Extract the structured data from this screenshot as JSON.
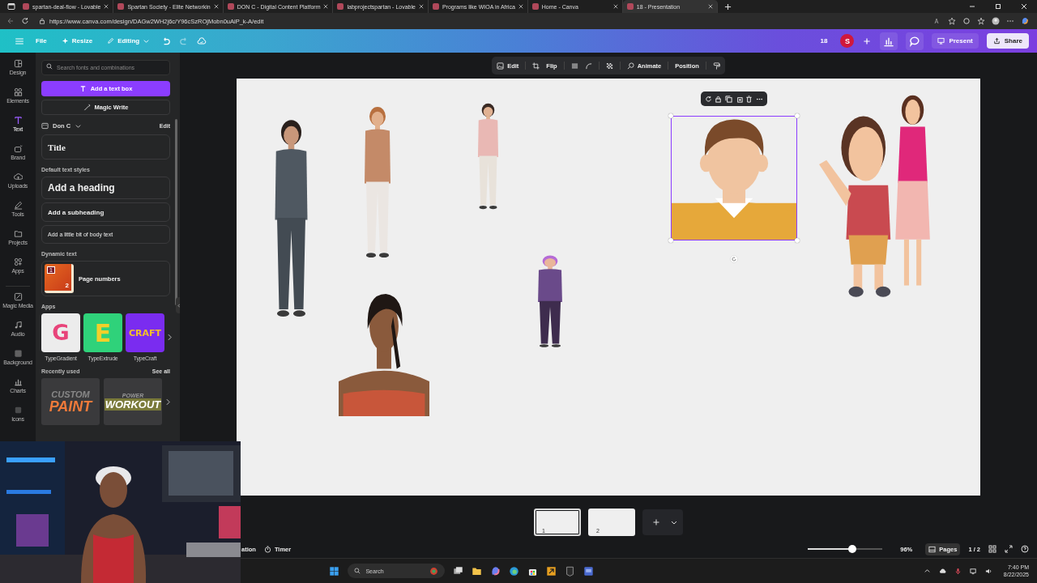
{
  "browser": {
    "tabs": [
      {
        "title": "spartan-deal-flow - Lovable",
        "selected": false
      },
      {
        "title": "Spartan Society - Elite Networkin",
        "selected": false
      },
      {
        "title": "DON C - Digital Content Platform",
        "selected": false
      },
      {
        "title": "labprojectspartan - Lovable",
        "selected": false
      },
      {
        "title": "Programs like WIOA in Africa",
        "selected": false
      },
      {
        "title": "Home - Canva",
        "selected": false
      },
      {
        "title": "18 - Presentation",
        "selected": true
      }
    ],
    "url": "https://www.canva.com/design/DAGw2WH2j6c/Y96cSzROjMobn0uAiP_k-A/edit"
  },
  "topbar": {
    "file": "File",
    "resize": "Resize",
    "mode": "Editing",
    "count": "18",
    "avatar": "S",
    "present": "Present",
    "share": "Share"
  },
  "rail": [
    {
      "label": "Design",
      "selected": false
    },
    {
      "label": "Elements",
      "selected": false
    },
    {
      "label": "Text",
      "selected": true
    },
    {
      "label": "Brand",
      "selected": false
    },
    {
      "label": "Uploads",
      "selected": false
    },
    {
      "label": "Tools",
      "selected": false
    },
    {
      "label": "Projects",
      "selected": false
    },
    {
      "label": "Apps",
      "selected": false
    },
    {
      "label": "Magic Media",
      "selected": false
    },
    {
      "label": "Audio",
      "selected": false
    },
    {
      "label": "Background",
      "selected": false
    },
    {
      "label": "Charts",
      "selected": false
    },
    {
      "label": "Icons",
      "selected": false
    }
  ],
  "panel": {
    "search_placeholder": "Search fonts and combinations",
    "add_text": "Add a text box",
    "magic_write": "Magic Write",
    "brand_kit": "Don C",
    "edit": "Edit",
    "title_style": "Title",
    "default_heading": "Default text styles",
    "styles": [
      {
        "kind": "heading",
        "label": "Add a heading"
      },
      {
        "kind": "subheading",
        "label": "Add a subheading"
      },
      {
        "kind": "body",
        "label": "Add a little bit of body text"
      }
    ],
    "dynamic_heading": "Dynamic text",
    "dynamic_item": "Page numbers",
    "dynamic_digits": [
      "1",
      "2"
    ],
    "apps_heading": "Apps",
    "apps": [
      {
        "name": "TypeGradient",
        "glyph": "G",
        "color": "#ececec"
      },
      {
        "name": "TypeExtrude",
        "glyph": "E",
        "color": "#2fd27a"
      },
      {
        "name": "TypeCraft",
        "glyph": "CRAFT",
        "color": "#7a2cf0"
      }
    ],
    "recent_heading": "Recently used",
    "see_all": "See all",
    "recent": [
      {
        "top": "CUSTOM",
        "bottom": "PAINT"
      },
      {
        "top": "POWER",
        "bottom": "WORKOUT"
      }
    ]
  },
  "context_toolbar": {
    "edit": "Edit",
    "flip": "Flip",
    "animate": "Animate",
    "position": "Position"
  },
  "canvas": {
    "elements": [
      {
        "kind": "standing",
        "selected": false
      },
      {
        "kind": "standing",
        "selected": false
      },
      {
        "kind": "standing",
        "selected": false
      },
      {
        "kind": "portrait",
        "selected": true
      },
      {
        "kind": "pair",
        "selected": false
      },
      {
        "kind": "standing",
        "selected": false
      },
      {
        "kind": "bust",
        "selected": false
      }
    ]
  },
  "pages": [
    {
      "number": "1",
      "selected": true
    },
    {
      "number": "2",
      "selected": false
    }
  ],
  "footer": {
    "notes": "ation",
    "timer": "Timer",
    "zoom": {
      "level": 0.6
    },
    "zoom_reading": "96%",
    "pages_button": "Pages",
    "page_count": "1 / 2"
  },
  "taskbar": {
    "search": "Search",
    "time": "7:40 PM",
    "date": "8/22/2025"
  }
}
